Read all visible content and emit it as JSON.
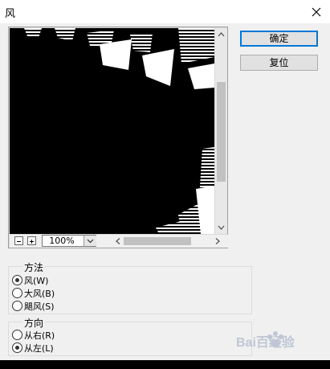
{
  "window": {
    "title": "风"
  },
  "preview": {
    "zoom": "100%"
  },
  "buttons": {
    "ok": "确定",
    "reset": "复位"
  },
  "method": {
    "title": "方法",
    "options": [
      {
        "label": "风(W)",
        "checked": true
      },
      {
        "label": "大风(B)",
        "checked": false
      },
      {
        "label": "飓风(S)",
        "checked": false
      }
    ]
  },
  "direction": {
    "title": "方向",
    "options": [
      {
        "label": "从右(R)",
        "checked": false
      },
      {
        "label": "从左(L)",
        "checked": true
      }
    ]
  },
  "icons": [
    "close-icon",
    "zoom-out-icon",
    "zoom-in-icon",
    "chevron-down-icon",
    "scroll-up-arrow-icon",
    "scroll-down-arrow-icon",
    "scroll-left-arrow-icon",
    "scroll-right-arrow-icon",
    "baidu-paw-logo"
  ],
  "watermark": {
    "text": "Bai百经验"
  },
  "colors": {
    "accent": "#0078d7",
    "canvas": "#000000"
  }
}
